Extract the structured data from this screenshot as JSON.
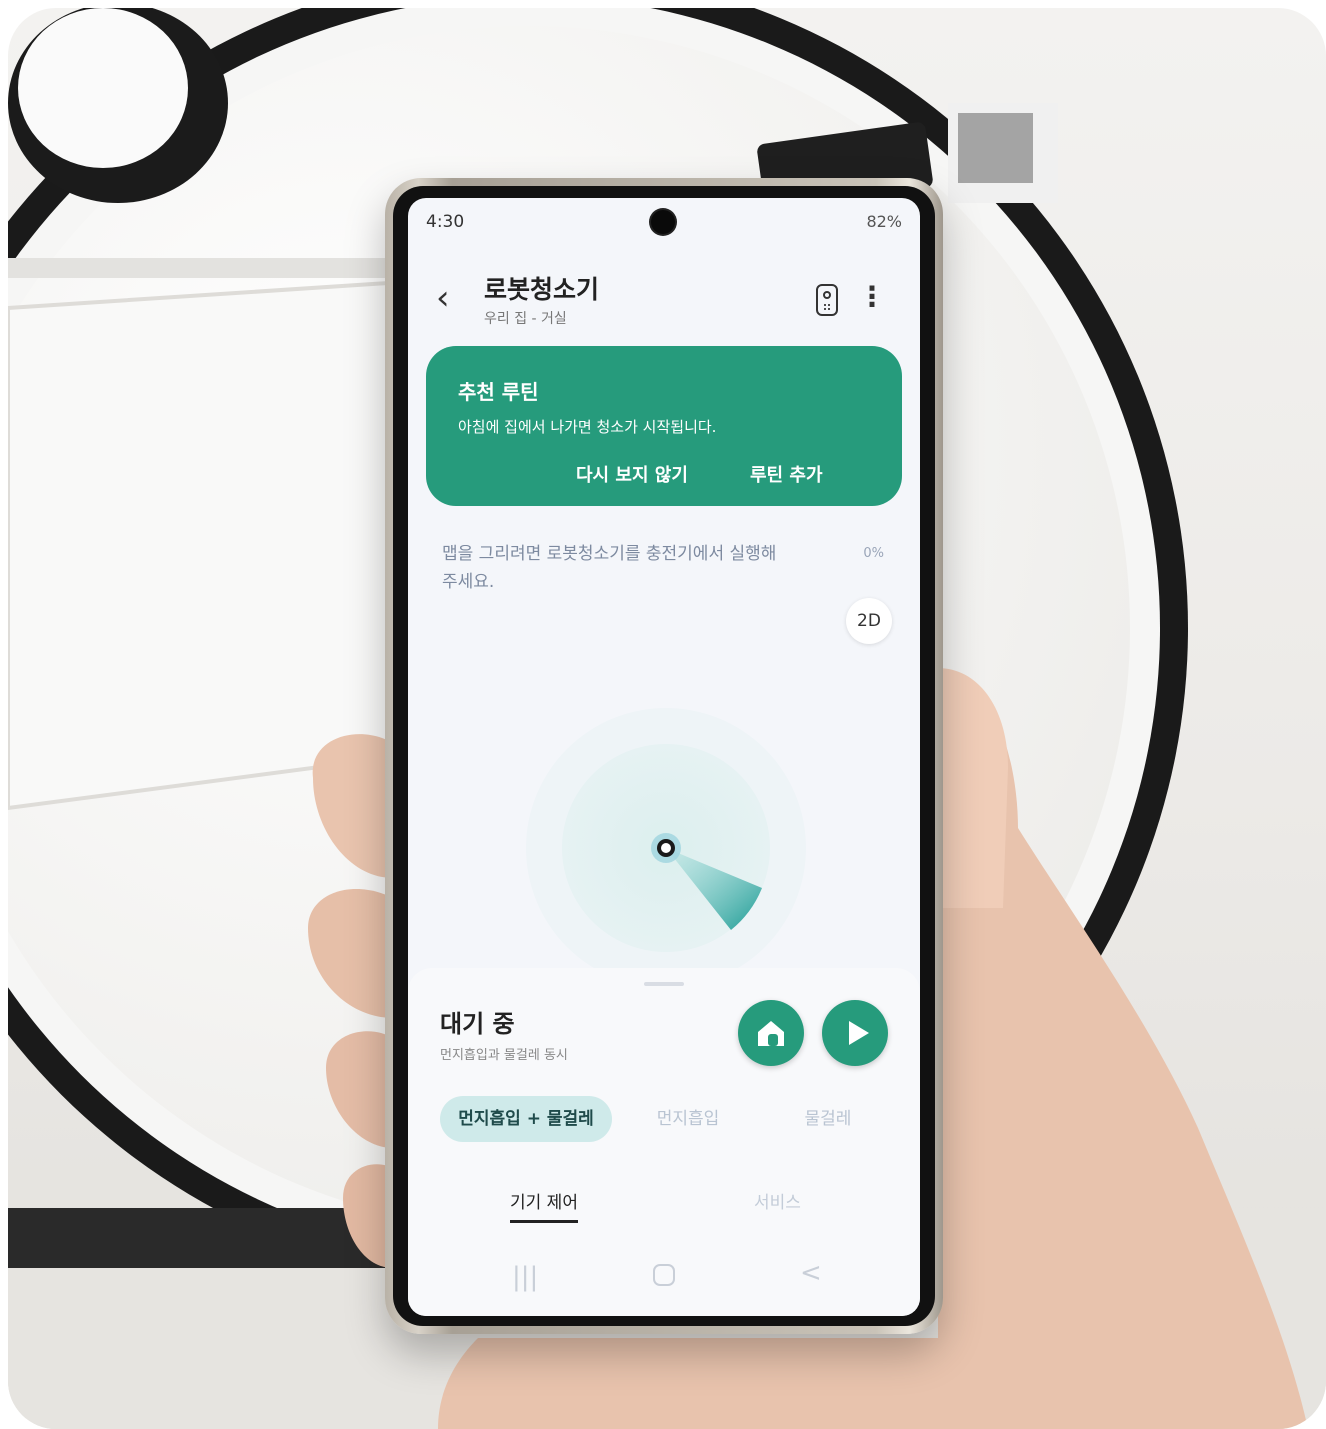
{
  "status": {
    "time": "4:30",
    "right": "82%"
  },
  "header": {
    "title": "로봇청소기",
    "subtitle": "우리 집 - 거실",
    "back_icon": "chevron-left-icon",
    "remote_icon": "remote-icon",
    "more_icon": "more-vertical-icon"
  },
  "routine": {
    "title": "추천 루틴",
    "description": "아침에 집에서 나가면 청소가 시작됩니다.",
    "dismiss_label": "다시 보지 않기",
    "add_label": "루틴 추가",
    "color": "#269b7c"
  },
  "map": {
    "message": "맵을 그리려면 로봇청소기를 충전기에서 실행해 주세요.",
    "percent": "0%",
    "view_toggle": "2D"
  },
  "panel": {
    "state": "대기 중",
    "state_sub": "먼지흡입과 물걸레 동시",
    "modes": [
      "먼지흡입 + 물걸레",
      "먼지흡입",
      "물걸레"
    ],
    "active_mode": "먼지흡입 + 물걸레",
    "tabs": [
      "기기 제어",
      "서비스"
    ],
    "dock_icon": "home-dock-icon",
    "play_icon": "play-icon"
  },
  "navbar": {
    "recent": "|||",
    "back": "<"
  }
}
